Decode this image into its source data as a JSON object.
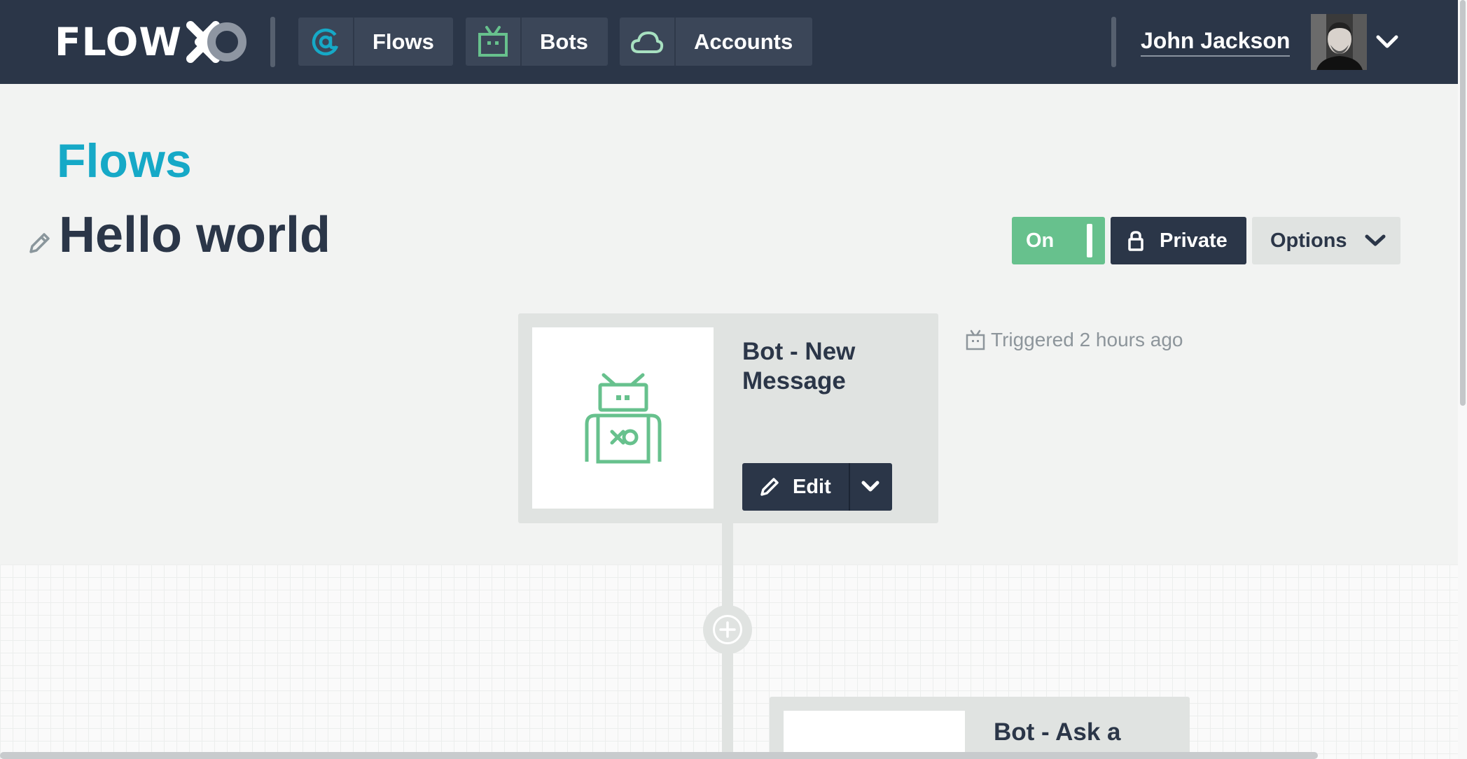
{
  "navbar": {
    "logo_text": "FLOW",
    "tabs": [
      {
        "label": "Flows",
        "icon": "at-icon"
      },
      {
        "label": "Bots",
        "icon": "robot-tv-icon"
      },
      {
        "label": "Accounts",
        "icon": "cloud-icon"
      }
    ],
    "user_name": "John Jackson"
  },
  "header": {
    "breadcrumb": "Flows",
    "title": "Hello world",
    "toggle_label": "On",
    "privacy_label": "Private",
    "options_label": "Options"
  },
  "steps": [
    {
      "title": "Bot - New Message",
      "edit_label": "Edit",
      "icon": "bot-icon"
    },
    {
      "title": "Bot - Ask a"
    }
  ],
  "status": {
    "triggered": "Triggered 2 hours ago",
    "icon": "bot-tv-icon"
  },
  "colors": {
    "nav_bg": "#2b3648",
    "accent_blue": "#16a9c7",
    "accent_green": "#67c18d",
    "page_bg": "#f2f3f2"
  }
}
